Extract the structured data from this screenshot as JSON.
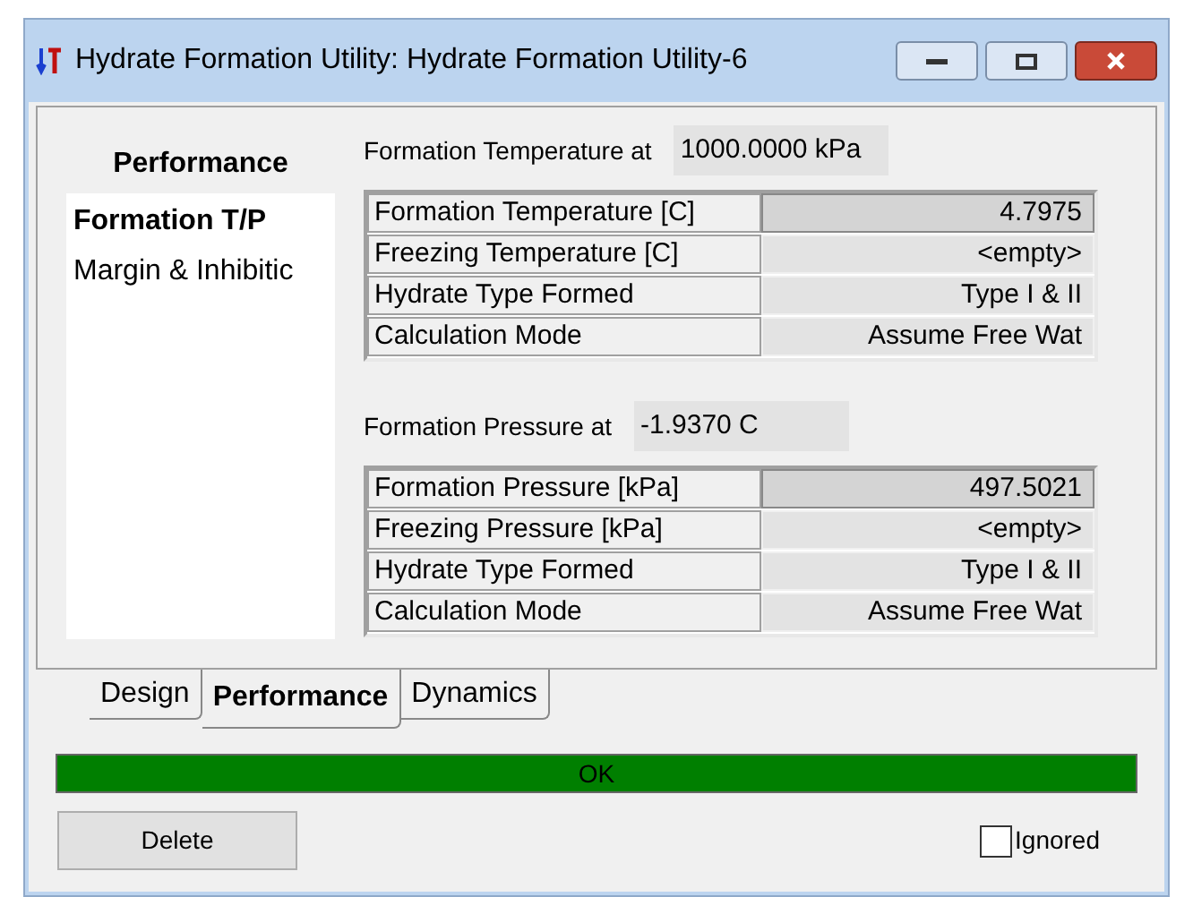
{
  "window": {
    "title": "Hydrate Formation Utility: Hydrate Formation Utility-6"
  },
  "nav": {
    "heading": "Performance",
    "items": [
      {
        "label": "Formation T/P",
        "selected": true
      },
      {
        "label": "Margin & Inhibitic",
        "selected": false
      }
    ]
  },
  "sections": [
    {
      "label": "Formation Temperature at",
      "value": "1000.0000 kPa",
      "rows": [
        {
          "name": "Formation Temperature [C]",
          "value": "4.7975",
          "highlighted": true
        },
        {
          "name": "Freezing Temperature [C]",
          "value": "<empty>",
          "highlighted": false
        },
        {
          "name": "Hydrate Type Formed",
          "value": "Type I & II",
          "highlighted": false
        },
        {
          "name": "Calculation Mode",
          "value": "Assume Free Wat",
          "highlighted": false
        }
      ]
    },
    {
      "label": "Formation Pressure at",
      "value": "-1.9370 C",
      "rows": [
        {
          "name": "Formation Pressure [kPa]",
          "value": "497.5021",
          "highlighted": true
        },
        {
          "name": "Freezing Pressure [kPa]",
          "value": "<empty>",
          "highlighted": false
        },
        {
          "name": "Hydrate Type Formed",
          "value": "Type I & II",
          "highlighted": false
        },
        {
          "name": "Calculation Mode",
          "value": "Assume Free Wat",
          "highlighted": false
        }
      ]
    }
  ],
  "tabs": [
    {
      "label": "Design",
      "selected": false
    },
    {
      "label": "Performance",
      "selected": true
    },
    {
      "label": "Dynamics",
      "selected": false
    }
  ],
  "status": {
    "text": "OK"
  },
  "delete_button": {
    "label": "Delete"
  },
  "ignored": {
    "label": "Ignored",
    "checked": false
  }
}
